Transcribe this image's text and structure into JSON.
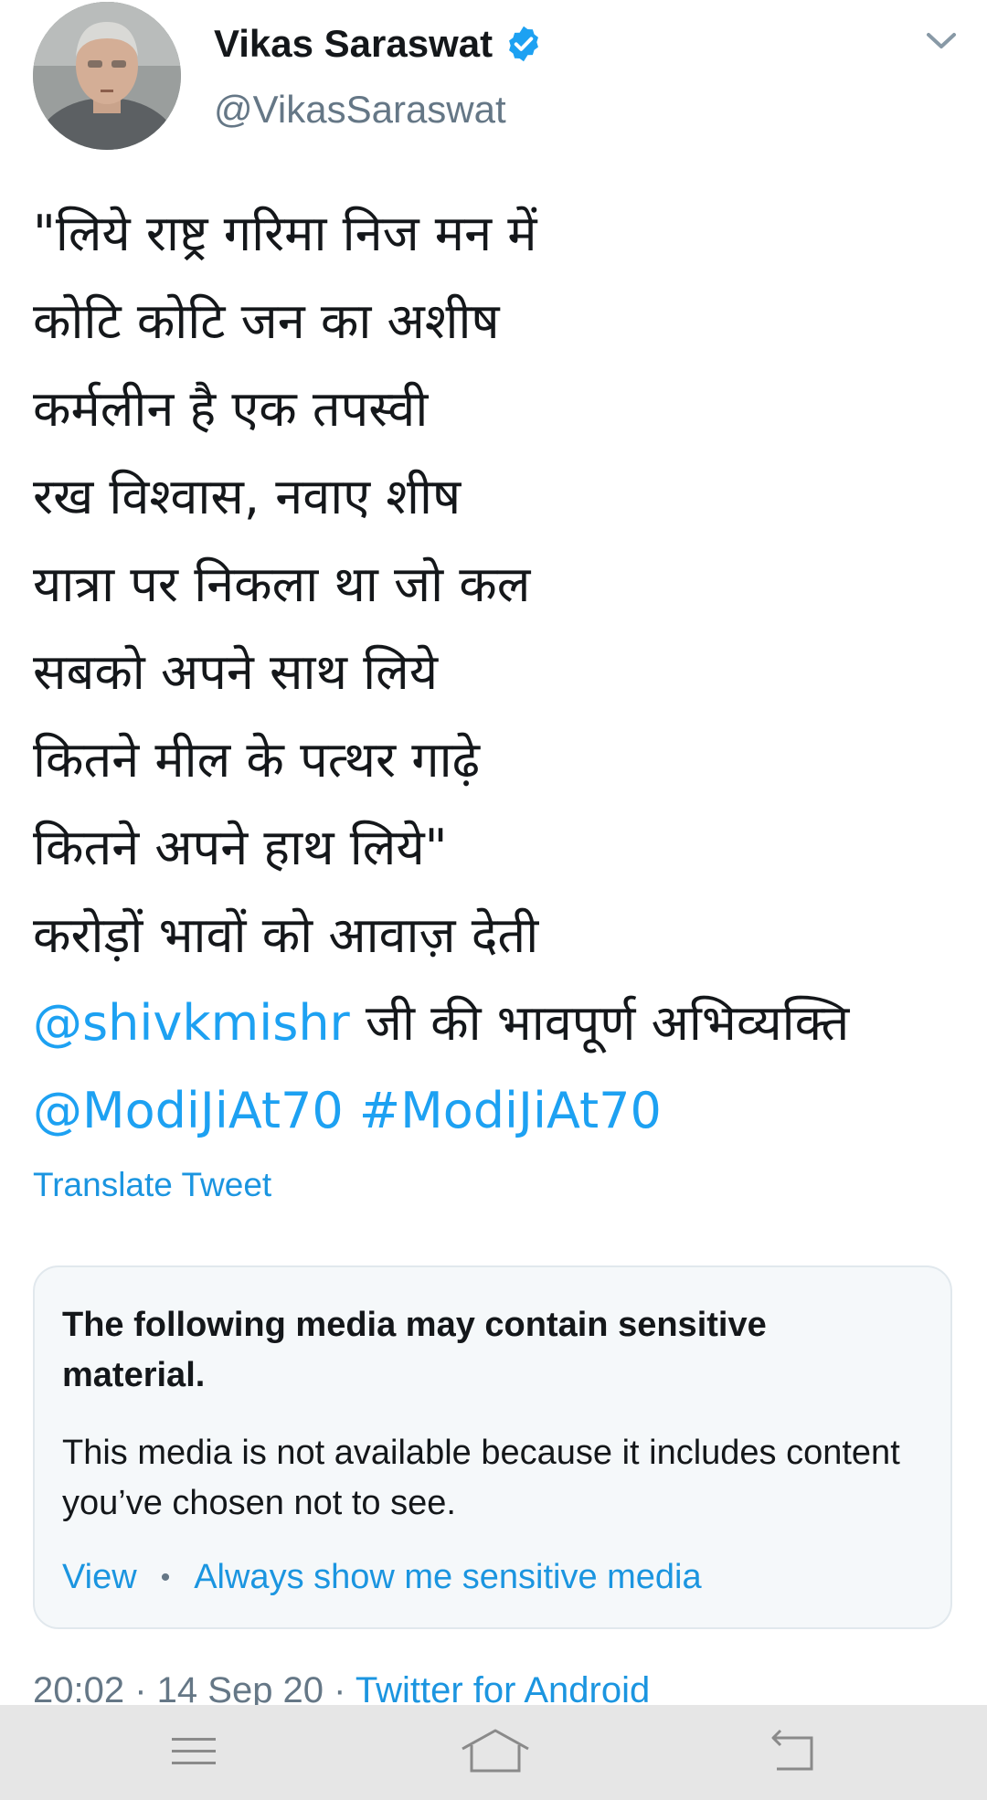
{
  "header": {
    "display_name": "Vikas Saraswat",
    "handle": "@VikasSaraswat",
    "verified_icon": "verified-badge-icon",
    "menu_icon": "chevron-down-icon"
  },
  "tweet": {
    "lines": [
      "\"लिये राष्ट्र गरिमा निज मन में",
      "कोटि कोटि जन का अशीष",
      "कर्मलीन है एक तपस्वी",
      "रख विश्वास, नवाए शीष",
      "यात्रा पर निकला था जो कल",
      "सबको अपने साथ लिये",
      "कितने मील के पत्थर गाढ़े",
      "कितने अपने हाथ लिये\"",
      "करोड़ों भावों को आवाज़ देती"
    ],
    "mention_1": "@shivkmishr",
    "line_10_rest": " जी की भावपूर्ण अभिव्यक्ति",
    "mention_2": "@ModiJiAt70",
    "hashtag": "#ModiJiAt70",
    "translate_label": "Translate Tweet"
  },
  "sensitive_card": {
    "title": "The following media may contain sensitive material.",
    "body": "This media is not available because it includes content you’ve chosen not to see.",
    "view_label": "View",
    "separator": "•",
    "always_show_label": "Always show me sensitive media"
  },
  "meta": {
    "time": "20:02",
    "sep_1": " · ",
    "date": "14 Sep 20",
    "sep_2": " · ",
    "source": "Twitter for Android"
  },
  "navbar": {
    "menu_icon": "menu-icon",
    "home_icon": "home-icon",
    "back_icon": "back-icon"
  },
  "colors": {
    "link": "#1b95e0",
    "verified": "#1da1f2",
    "secondary_text": "#657786",
    "card_bg": "#f5f8fa",
    "card_border": "#e1e8ed",
    "navbar_bg": "#e6e6e6"
  }
}
